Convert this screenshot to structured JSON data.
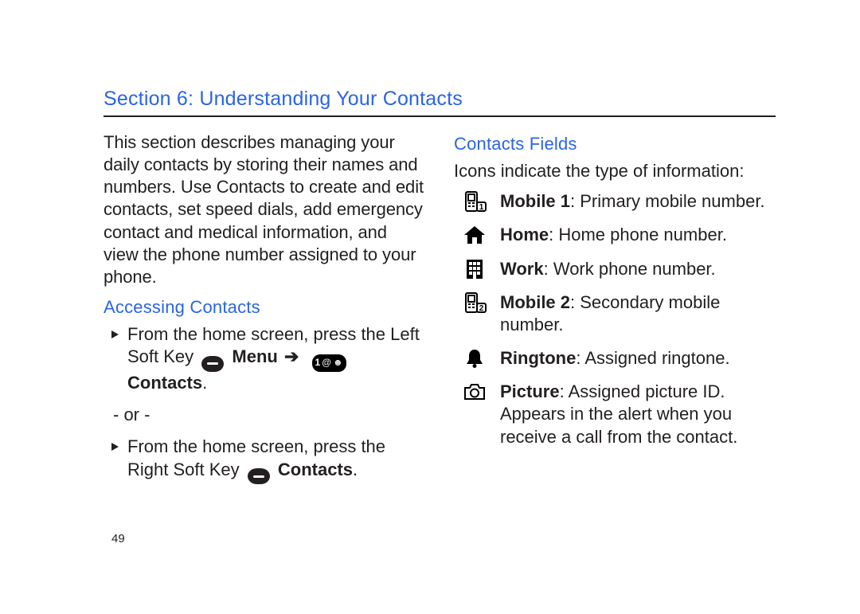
{
  "section_title": "Section 6: Understanding Your Contacts",
  "page_number": "49",
  "left": {
    "intro": "This section describes managing your daily contacts by storing their names and numbers. Use Contacts to create and edit contacts, set speed dials, add emergency contact and medical information, and view the phone number assigned to your phone.",
    "accessing_heading": "Accessing Contacts",
    "step1_a": "From the home screen, press the Left Soft Key ",
    "step1_menu": "Menu",
    "step1_arrow": "➔",
    "step1_contacts": "Contacts",
    "step1_period": ".",
    "or_sep": "- or -",
    "step2_a": "From the home screen, press the Right Soft Key ",
    "step2_contacts": "Contacts",
    "step2_period": "."
  },
  "right": {
    "heading": "Contacts Fields",
    "intro": "Icons indicate the type of information:",
    "fields": {
      "mobile1_label": "Mobile 1",
      "mobile1_desc": ": Primary mobile number.",
      "home_label": "Home",
      "home_desc": ": Home phone number.",
      "work_label": "Work",
      "work_desc": ": Work phone number.",
      "mobile2_label": "Mobile 2",
      "mobile2_desc": ": Secondary mobile number.",
      "ringtone_label": "Ringtone",
      "ringtone_desc": ": Assigned ringtone.",
      "picture_label": "Picture",
      "picture_desc": ": Assigned picture ID. Appears in the alert when you receive a call from the contact."
    }
  },
  "icons": {
    "softkey": "softkey-dash",
    "contacts_inline": "1@person",
    "arrow": "➔"
  }
}
